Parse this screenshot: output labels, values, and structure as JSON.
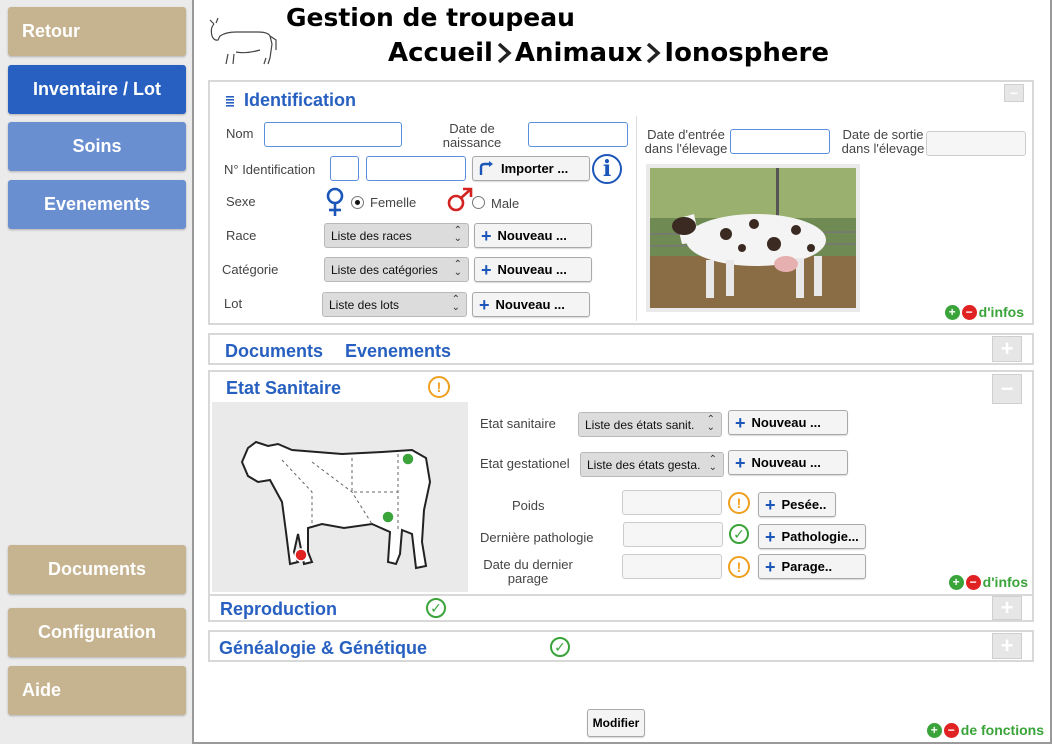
{
  "nav": {
    "retour": "Retour",
    "inventaire": "Inventaire / Lot",
    "soins": "Soins",
    "evenements": "Evenements",
    "documents": "Documents",
    "configuration": "Configuration",
    "aide": "Aide"
  },
  "header": {
    "title": "Gestion de troupeau",
    "breadcrumb": [
      "Accueil",
      "Animaux",
      "Ionosphere"
    ]
  },
  "identification": {
    "title": "Identification",
    "nom_label": "Nom",
    "date_naissance_label": "Date de naissance",
    "num_id_label": "N° Identification",
    "importer_label": "Importer ...",
    "sexe_label": "Sexe",
    "femelle_label": "Femelle",
    "male_label": "Male",
    "race_label": "Race",
    "race_select": "Liste des races",
    "categorie_label": "Catégorie",
    "categorie_select": "Liste des catégories",
    "lot_label": "Lot",
    "lot_select": "Liste des lots",
    "nouveau_label": "Nouveau ...",
    "date_entree_label": "Date d'entrée dans l'élevage",
    "date_sortie_label": "Date de sortie dans l'élevage",
    "infos_label": "d'infos"
  },
  "tabs": {
    "documents": "Documents",
    "evenements": "Evenements"
  },
  "etat": {
    "title": "Etat Sanitaire",
    "etat_sanitaire_label": "Etat sanitaire",
    "etat_sanitaire_select": "Liste des états sanit.",
    "etat_gestationel_label": "Etat gestationel",
    "etat_gestationel_select": "Liste des états gesta.",
    "nouveau_label": "Nouveau ...",
    "poids_label": "Poids",
    "pesee_label": "Pesée..",
    "pathologie_label": "Dernière  pathologie",
    "pathologie_btn": "Pathologie...",
    "parage_label": "Date du dernier parage",
    "parage_btn": "Parage..",
    "infos_label": "d'infos"
  },
  "reproduction": {
    "title": "Reproduction"
  },
  "genealogie": {
    "title": "Généalogie & Génétique"
  },
  "footer": {
    "modifier": "Modifier",
    "fonctions": "de fonctions"
  },
  "colors": {
    "accent_blue": "#2760c0",
    "nav_blue": "#6a8fd1",
    "nav_tan": "#c6b38f",
    "ok_green": "#3aa33a",
    "warn_orange": "#f0a020",
    "alert_red": "#e02222"
  }
}
